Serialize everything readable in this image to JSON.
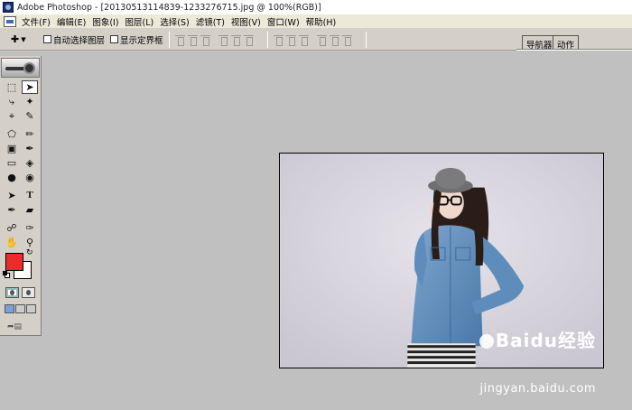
{
  "window": {
    "title": "Adobe Photoshop - [20130513114839-1233276715.jpg @ 100%(RGB)]"
  },
  "menu": {
    "items": [
      "文件(F)",
      "编辑(E)",
      "图象(I)",
      "图层(L)",
      "选择(S)",
      "滤镜(T)",
      "视图(V)",
      "窗口(W)",
      "帮助(H)"
    ]
  },
  "options": {
    "auto_select_label": "自动选择图层",
    "show_bounds_label": "显示定界框"
  },
  "palette_well": {
    "tabs": [
      "导航器",
      "动作"
    ]
  },
  "toolbox": {
    "foreground_color": "#ee2b2b",
    "background_color": "#ffffff",
    "tools": [
      "marquee-icon",
      "move-icon",
      "lasso-icon",
      "magic-wand-icon",
      "crop-icon",
      "slice-icon",
      "healing-brush-icon",
      "brush-icon",
      "clone-stamp-icon",
      "history-brush-icon",
      "eraser-icon",
      "paint-bucket-icon",
      "blur-icon",
      "dodge-icon",
      "path-selection-icon",
      "type-icon",
      "pen-icon",
      "shape-icon",
      "notes-icon",
      "eyedropper-icon",
      "hand-icon",
      "zoom-icon"
    ]
  },
  "watermark": {
    "logo": "Baidu经验",
    "url": "jingyan.baidu.com"
  }
}
